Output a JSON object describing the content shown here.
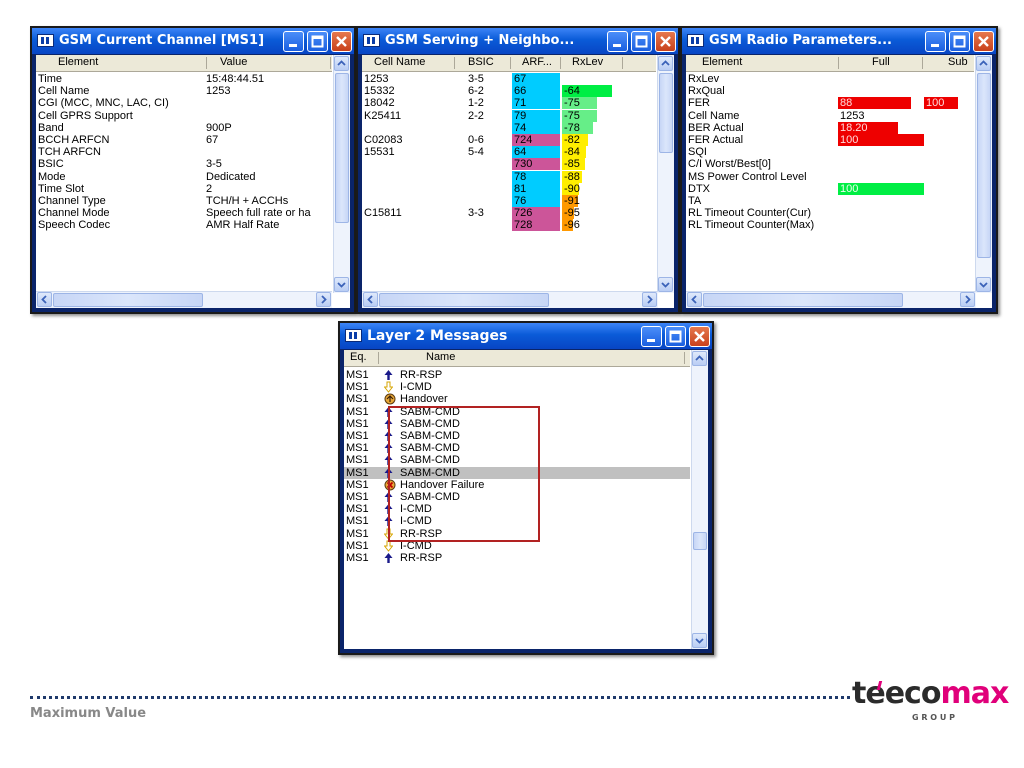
{
  "colors": {
    "title_blue": "#0a5bd8",
    "cyan": "#00ccff",
    "magenta": "#cc5599",
    "green": "#00ee44",
    "light_green": "#66ee88",
    "yellow": "#ffee00",
    "orange": "#ff9900",
    "red": "#ee0000",
    "highlight_box": "#b22222"
  },
  "win1": {
    "title": "GSM Current Channel [MS1]",
    "col_element": "Element",
    "col_value": "Value",
    "rows": [
      {
        "element": "Time",
        "value": "15:48:44.51"
      },
      {
        "element": "Cell Name",
        "value": "1253"
      },
      {
        "element": "CGI (MCC, MNC, LAC, CI)",
        "value": ""
      },
      {
        "element": "Cell GPRS Support",
        "value": ""
      },
      {
        "element": "Band",
        "value": "900P"
      },
      {
        "element": "BCCH ARFCN",
        "value": "67"
      },
      {
        "element": "TCH ARFCN",
        "value": ""
      },
      {
        "element": "BSIC",
        "value": "3-5"
      },
      {
        "element": "Mode",
        "value": "Dedicated"
      },
      {
        "element": "Time Slot",
        "value": "2"
      },
      {
        "element": "Channel Type",
        "value": "TCH/H + ACCHs"
      },
      {
        "element": "Channel Mode",
        "value": "Speech full rate or ha"
      },
      {
        "element": "Speech Codec",
        "value": "AMR Half Rate"
      }
    ]
  },
  "win2": {
    "title": "GSM Serving + Neighbo...",
    "col_cell": "Cell Name",
    "col_bsic": "BSIC",
    "col_arfcn": "ARF...",
    "col_rxlev": "RxLev",
    "rows": [
      {
        "cell": "1253",
        "bsic": "3-5",
        "arfcn": "67",
        "rxlev": "",
        "ac": "cyan",
        "rc": ""
      },
      {
        "cell": "15332",
        "bsic": "6-2",
        "arfcn": "66",
        "rxlev": "-64",
        "ac": "cyan",
        "rc": "green",
        "rl": 0.9
      },
      {
        "cell": "18042",
        "bsic": "1-2",
        "arfcn": "71",
        "rxlev": "-75",
        "ac": "cyan",
        "rc": "light_green",
        "rl": 0.62
      },
      {
        "cell": "K25411",
        "bsic": "2-2",
        "arfcn": "79",
        "rxlev": "-75",
        "ac": "cyan",
        "rc": "light_green",
        "rl": 0.62
      },
      {
        "cell": "",
        "bsic": "",
        "arfcn": "74",
        "rxlev": "-78",
        "ac": "cyan",
        "rc": "light_green",
        "rl": 0.55
      },
      {
        "cell": "C02083",
        "bsic": "0-6",
        "arfcn": "724",
        "rxlev": "-82",
        "ac": "magenta",
        "rc": "yellow",
        "rl": 0.47
      },
      {
        "cell": "15531",
        "bsic": "5-4",
        "arfcn": "64",
        "rxlev": "-84",
        "ac": "cyan",
        "rc": "yellow",
        "rl": 0.43
      },
      {
        "cell": "",
        "bsic": "",
        "arfcn": "730",
        "rxlev": "-85",
        "ac": "magenta",
        "rc": "yellow",
        "rl": 0.41
      },
      {
        "cell": "",
        "bsic": "",
        "arfcn": "78",
        "rxlev": "-88",
        "ac": "cyan",
        "rc": "yellow",
        "rl": 0.35
      },
      {
        "cell": "",
        "bsic": "",
        "arfcn": "81",
        "rxlev": "-90",
        "ac": "cyan",
        "rc": "yellow",
        "rl": 0.31
      },
      {
        "cell": "",
        "bsic": "",
        "arfcn": "76",
        "rxlev": "-91",
        "ac": "cyan",
        "rc": "orange",
        "rl": 0.29
      },
      {
        "cell": "C15811",
        "bsic": "3-3",
        "arfcn": "726",
        "rxlev": "-95",
        "ac": "magenta",
        "rc": "orange",
        "rl": 0.21
      },
      {
        "cell": "",
        "bsic": "",
        "arfcn": "728",
        "rxlev": "-96",
        "ac": "magenta",
        "rc": "orange",
        "rl": 0.19
      }
    ]
  },
  "win3": {
    "title": "GSM Radio Parameters...",
    "col_element": "Element",
    "col_full": "Full",
    "col_sub": "Sub",
    "rows": [
      {
        "element": "RxLev",
        "full": "",
        "fc": "",
        "fl": 0,
        "sub": "",
        "sc": "",
        "sl": 0
      },
      {
        "element": "RxQual",
        "full": "",
        "fc": "",
        "fl": 0,
        "sub": "",
        "sc": "",
        "sl": 0
      },
      {
        "element": "FER",
        "full": "88",
        "fc": "red",
        "fl": 0.85,
        "sub": "100",
        "sc": "red",
        "sl": 1
      },
      {
        "element": "Cell Name",
        "full": "1253",
        "fc": "",
        "fl": 0,
        "sub": "",
        "sc": "",
        "sl": 0
      },
      {
        "element": "BER Actual",
        "full": "18.20",
        "fc": "red",
        "fl": 0.7,
        "sub": "",
        "sc": "",
        "sl": 0
      },
      {
        "element": "FER Actual",
        "full": "100",
        "fc": "red",
        "fl": 1,
        "sub": "",
        "sc": "",
        "sl": 0
      },
      {
        "element": "SQI",
        "full": "",
        "fc": "",
        "fl": 0,
        "sub": "",
        "sc": "",
        "sl": 0
      },
      {
        "element": "C/I Worst/Best[0]",
        "full": "",
        "fc": "",
        "fl": 0,
        "sub": "",
        "sc": "",
        "sl": 0
      },
      {
        "element": "MS Power Control Level",
        "full": "",
        "fc": "",
        "fl": 0,
        "sub": "",
        "sc": "",
        "sl": 0
      },
      {
        "element": "DTX",
        "full": "100",
        "fc": "green",
        "fl": 1,
        "sub": "",
        "sc": "",
        "sl": 0
      },
      {
        "element": "TA",
        "full": "",
        "fc": "",
        "fl": 0,
        "sub": "",
        "sc": "",
        "sl": 0
      },
      {
        "element": "RL Timeout Counter(Cur)",
        "full": "",
        "fc": "",
        "fl": 0,
        "sub": "",
        "sc": "",
        "sl": 0
      },
      {
        "element": "RL Timeout Counter(Max)",
        "full": "",
        "fc": "",
        "fl": 0,
        "sub": "",
        "sc": "",
        "sl": 0
      }
    ]
  },
  "win4": {
    "title": "Layer 2 Messages",
    "col_eq": "Eq.",
    "col_name": "Name",
    "rows": [
      {
        "eq": "MS1",
        "icon": "up",
        "name": "RR-RSP"
      },
      {
        "eq": "MS1",
        "icon": "down",
        "name": "I-CMD"
      },
      {
        "eq": "MS1",
        "icon": "handover",
        "name": "Handover"
      },
      {
        "eq": "MS1",
        "icon": "up",
        "name": "SABM-CMD"
      },
      {
        "eq": "MS1",
        "icon": "up",
        "name": "SABM-CMD"
      },
      {
        "eq": "MS1",
        "icon": "up",
        "name": "SABM-CMD"
      },
      {
        "eq": "MS1",
        "icon": "up",
        "name": "SABM-CMD"
      },
      {
        "eq": "MS1",
        "icon": "up",
        "name": "SABM-CMD"
      },
      {
        "eq": "MS1",
        "icon": "up",
        "name": "SABM-CMD",
        "selected": true
      },
      {
        "eq": "MS1",
        "icon": "failure",
        "name": "Handover Failure"
      },
      {
        "eq": "MS1",
        "icon": "up",
        "name": "SABM-CMD"
      },
      {
        "eq": "MS1",
        "icon": "up",
        "name": "I-CMD"
      },
      {
        "eq": "MS1",
        "icon": "up",
        "name": "I-CMD"
      },
      {
        "eq": "MS1",
        "icon": "down",
        "name": "RR-RSP"
      },
      {
        "eq": "MS1",
        "icon": "down",
        "name": "I-CMD"
      },
      {
        "eq": "MS1",
        "icon": "up",
        "name": "RR-RSP"
      }
    ]
  },
  "footer": {
    "caption": "Maximum Value",
    "logo_te": "te",
    "logo_eco": "eco",
    "logo_max": "max",
    "logo_group": "G R O U P"
  }
}
